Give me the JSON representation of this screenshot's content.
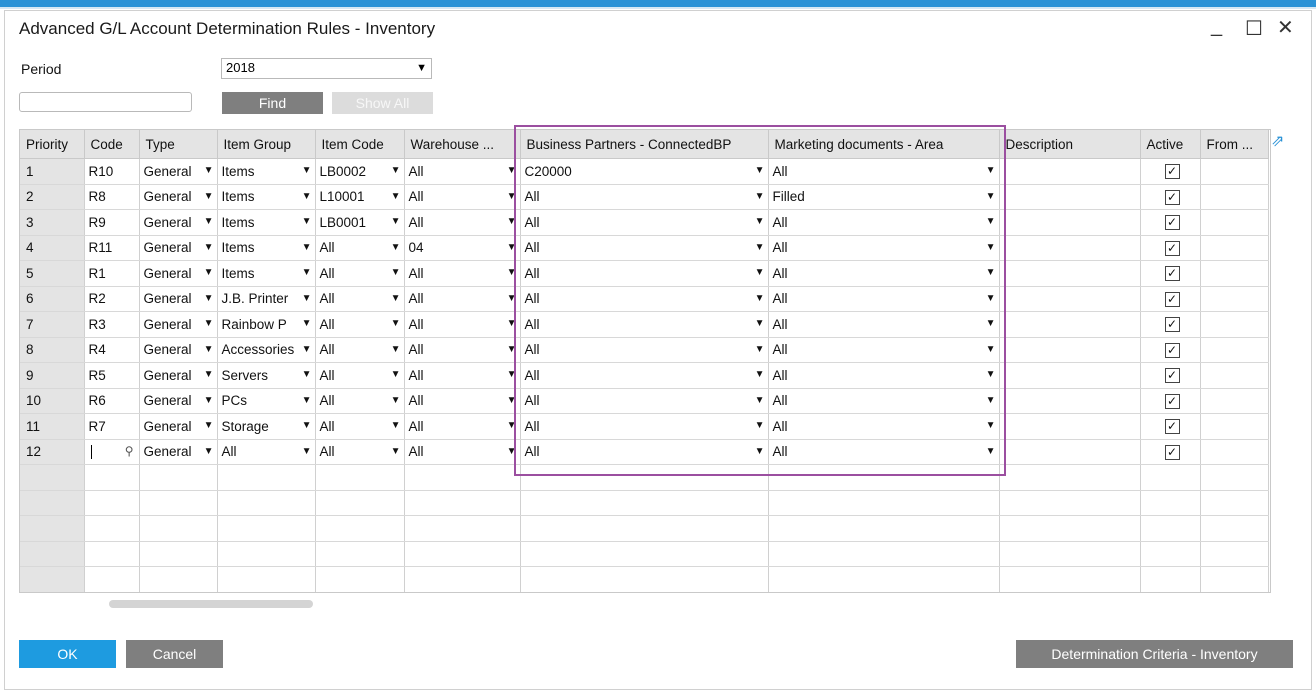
{
  "window": {
    "title": "Advanced G/L Account Determination Rules - Inventory",
    "minimize": "_",
    "maximize": "☐",
    "close": "✕"
  },
  "filters": {
    "period_label": "Period",
    "period_value": "2018",
    "search_value": "",
    "find_label": "Find",
    "show_all_label": "Show All"
  },
  "table": {
    "columns": [
      "Priority",
      "Code",
      "Type",
      "Item Group",
      "Item Code",
      "Warehouse ...",
      "Business Partners - ConnectedBP",
      "Marketing documents - Area",
      "Description",
      "Active",
      "From ..."
    ],
    "rows": [
      {
        "priority": "1",
        "code": "R10",
        "type": "General",
        "item_group": "Items",
        "item_code": "LB0002",
        "warehouse": "All",
        "bp": "C20000",
        "area": "All",
        "description": "",
        "active": true
      },
      {
        "priority": "2",
        "code": "R8",
        "type": "General",
        "item_group": "Items",
        "item_code": "L10001",
        "warehouse": "All",
        "bp": "All",
        "area": "Filled",
        "description": "",
        "active": true
      },
      {
        "priority": "3",
        "code": "R9",
        "type": "General",
        "item_group": "Items",
        "item_code": "LB0001",
        "warehouse": "All",
        "bp": "All",
        "area": "All",
        "description": "",
        "active": true
      },
      {
        "priority": "4",
        "code": "R11",
        "type": "General",
        "item_group": "Items",
        "item_code": "All",
        "warehouse": "04",
        "bp": "All",
        "area": "All",
        "description": "",
        "active": true
      },
      {
        "priority": "5",
        "code": "R1",
        "type": "General",
        "item_group": "Items",
        "item_code": "All",
        "warehouse": "All",
        "bp": "All",
        "area": "All",
        "description": "",
        "active": true
      },
      {
        "priority": "6",
        "code": "R2",
        "type": "General",
        "item_group": "J.B. Printer",
        "item_code": "All",
        "warehouse": "All",
        "bp": "All",
        "area": "All",
        "description": "",
        "active": true
      },
      {
        "priority": "7",
        "code": "R3",
        "type": "General",
        "item_group": "Rainbow P",
        "item_code": "All",
        "warehouse": "All",
        "bp": "All",
        "area": "All",
        "description": "",
        "active": true
      },
      {
        "priority": "8",
        "code": "R4",
        "type": "General",
        "item_group": "Accessories",
        "item_code": "All",
        "warehouse": "All",
        "bp": "All",
        "area": "All",
        "description": "",
        "active": true
      },
      {
        "priority": "9",
        "code": "R5",
        "type": "General",
        "item_group": "Servers",
        "item_code": "All",
        "warehouse": "All",
        "bp": "All",
        "area": "All",
        "description": "",
        "active": true
      },
      {
        "priority": "10",
        "code": "R6",
        "type": "General",
        "item_group": "PCs",
        "item_code": "All",
        "warehouse": "All",
        "bp": "All",
        "area": "All",
        "description": "",
        "active": true
      },
      {
        "priority": "11",
        "code": "R7",
        "type": "General",
        "item_group": "Storage",
        "item_code": "All",
        "warehouse": "All",
        "bp": "All",
        "area": "All",
        "description": "",
        "active": true
      },
      {
        "priority": "12",
        "code": "",
        "type": "General",
        "item_group": "All",
        "item_code": "All",
        "warehouse": "All",
        "bp": "All",
        "area": "All",
        "description": "",
        "active": true
      }
    ],
    "empty_rows": 5
  },
  "footer": {
    "ok_label": "OK",
    "cancel_label": "Cancel",
    "criteria_label": "Determination Criteria - Inventory"
  },
  "colors": {
    "accent": "#1e9be0",
    "highlight": "#9b4fa0",
    "header_bg": "#e4e4e4"
  },
  "icons": {
    "column_sort": "table-link-icon",
    "link_arrow": "link-arrow-icon",
    "dropdown": "dropdown-arrow-icon",
    "checkbox": "checkbox-checked-icon"
  }
}
